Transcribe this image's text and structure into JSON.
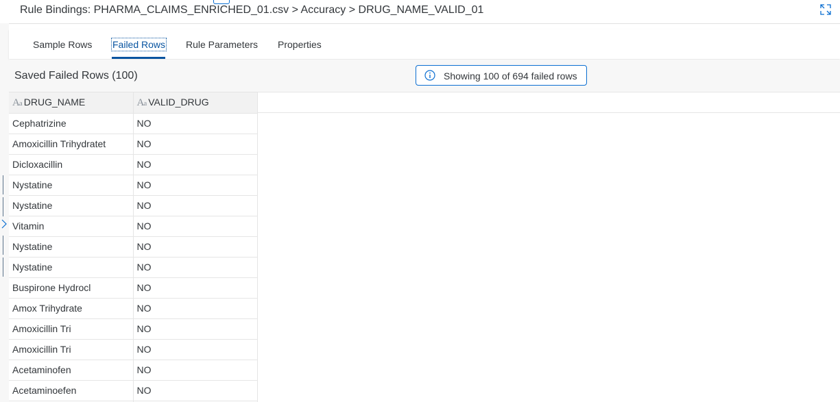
{
  "window": {
    "title": "Rule Bindings: PHARMA_CLAIMS_ENRICHED_01.csv > Accuracy > DRUG_NAME_VALID_01",
    "expand_icon": "expand-icon"
  },
  "tabs": [
    {
      "label": "Sample Rows",
      "active": false
    },
    {
      "label": "Failed Rows",
      "active": true
    },
    {
      "label": "Rule Parameters",
      "active": false
    },
    {
      "label": "Properties",
      "active": false
    }
  ],
  "section": {
    "title": "Saved Failed Rows (100)"
  },
  "info": {
    "icon": "info-icon",
    "text": "Showing 100 of 694 failed rows"
  },
  "table": {
    "type_icon": "string-type-icon",
    "columns": [
      "DRUG_NAME",
      "VALID_DRUG"
    ],
    "rows": [
      [
        "Cephatrizine",
        "NO"
      ],
      [
        "Amoxicillin Trihydratet",
        "NO"
      ],
      [
        "Dicloxacillin",
        "NO"
      ],
      [
        "Nystatine",
        "NO"
      ],
      [
        "Nystatine",
        "NO"
      ],
      [
        "Vitamin",
        "NO"
      ],
      [
        "Nystatine",
        "NO"
      ],
      [
        "Nystatine",
        "NO"
      ],
      [
        "Buspirone Hydrocl",
        "NO"
      ],
      [
        "Amox Trihydrate",
        "NO"
      ],
      [
        "Amoxicillin Tri",
        "NO"
      ],
      [
        "Amoxicillin Tri",
        "NO"
      ],
      [
        "Acetaminofen",
        "NO"
      ],
      [
        "Acetaminoefen",
        "NO"
      ]
    ]
  },
  "colors": {
    "accent": "#0854a0",
    "info_border": "#0a6ed1",
    "content_bg": "#f7f7f7"
  }
}
